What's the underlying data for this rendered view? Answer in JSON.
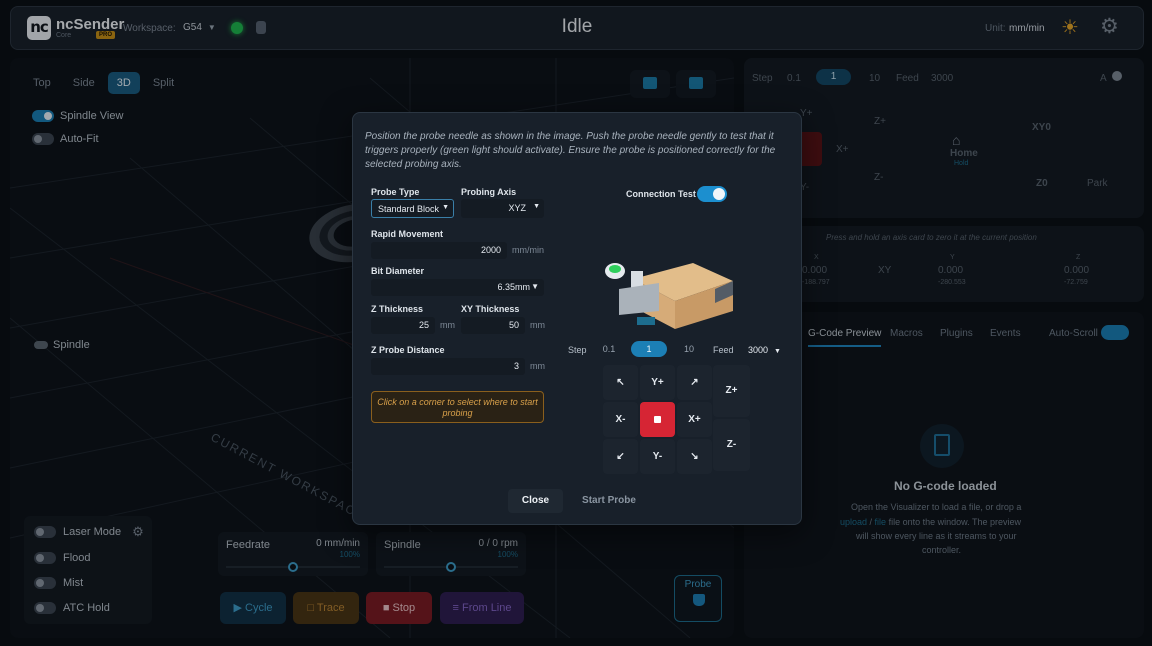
{
  "header": {
    "app_name": "ncSender",
    "app_sub": "Core",
    "pro_badge": "PRO",
    "workspace_label": "Workspace:",
    "workspace_value": "G54",
    "state": "Idle",
    "unit_label": "Unit:",
    "unit_value": "mm/min"
  },
  "viz": {
    "tabs": [
      {
        "label": "Top",
        "active": false
      },
      {
        "label": "Side",
        "active": false
      },
      {
        "label": "3D",
        "active": true
      },
      {
        "label": "Split",
        "active": false
      }
    ],
    "spindle_view": "Spindle View",
    "auto_fit": "Auto-Fit",
    "spindle": "Spindle",
    "workspace_text": "CURRENT WORKSPACE"
  },
  "machine": {
    "laser_mode": "Laser Mode",
    "flood": "Flood",
    "mist": "Mist",
    "atc_hold": "ATC Hold"
  },
  "overrides": {
    "feedrate_label": "Feedrate",
    "feedrate_value": "0 mm/min",
    "feedrate_pct": "100%",
    "spindle_label": "Spindle",
    "spindle_value": "0 / 0 rpm",
    "spindle_pct": "100%"
  },
  "run": {
    "cycle": "Cycle",
    "trace": "Trace",
    "stop": "Stop",
    "from_line": "From Line",
    "probe": "Probe"
  },
  "jog_panel": {
    "step_label": "Step",
    "steps": [
      "0.1",
      "1",
      "10"
    ],
    "feed_label": "Feed",
    "feed_value": "3000",
    "a_label": "A",
    "yplus": "Y+",
    "xplus": "X+",
    "yminus": "Y-",
    "zplus": "Z+",
    "zminus": "Z-",
    "home": "Home",
    "home_sub": "Hold",
    "xy0": "XY0",
    "z0": "Z0",
    "park": "Park"
  },
  "axes": {
    "hint": "Press and hold an axis card to zero it at the current position",
    "x_label": "X",
    "x_value": "0.000",
    "x_sub": "-188.797",
    "xy_label": "XY",
    "y_label": "Y",
    "y_value": "0.000",
    "y_sub": "-280.553",
    "z_label": "Z",
    "z_value": "0.000",
    "z_sub": "-72.759"
  },
  "tabs": {
    "gcode": "G-Code Preview",
    "macros": "Macros",
    "plugins": "Plugins",
    "events": "Events",
    "auto_scroll": "Auto-Scroll",
    "empty_title": "No G-code loaded",
    "empty_line1": "Open the Visualizer to load a file, or drop a",
    "empty_line2_a": "upload",
    "empty_line2_b": "file",
    "empty_line2_c": "file onto the window. The preview",
    "empty_line3": "will show every line as it streams to your",
    "empty_line4": "controller."
  },
  "modal": {
    "instructions": "Position the probe needle as shown in the image. Push the probe needle gently to test that it triggers properly (green light should activate). Ensure the probe is positioned correctly for the selected probing axis.",
    "probe_type_label": "Probe Type",
    "probe_type_value": "Standard Block",
    "probing_axis_label": "Probing Axis",
    "probing_axis_value": "XYZ",
    "connection_test": "Connection Test",
    "rapid_label": "Rapid Movement",
    "rapid_value": "2000",
    "rapid_unit": "mm/min",
    "bit_label": "Bit Diameter",
    "bit_value": "6.35mm",
    "zthick_label": "Z Thickness",
    "zthick_value": "25",
    "xythick_label": "XY Thickness",
    "xythick_value": "50",
    "mm": "mm",
    "zdist_label": "Z Probe Distance",
    "zdist_value": "3",
    "hint": "Click on a corner to select where to start probing",
    "step_label": "Step",
    "steps": [
      "0.1",
      "1",
      "10"
    ],
    "feed_label": "Feed",
    "feed_value": "3000",
    "jog": {
      "yplus": "Y+",
      "yminus": "Y-",
      "xplus": "X+",
      "xminus": "X-",
      "zplus": "Z+",
      "zminus": "Z-"
    },
    "close": "Close",
    "start_probe": "Start Probe"
  }
}
